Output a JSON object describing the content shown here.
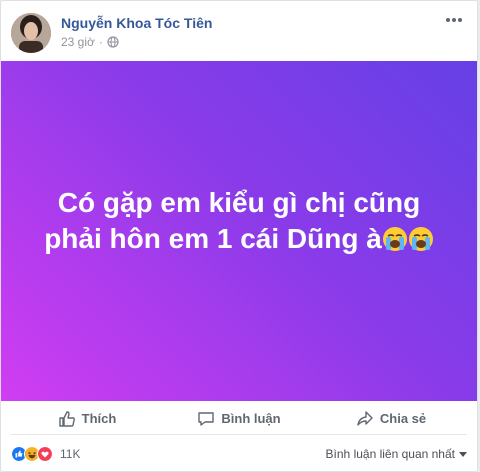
{
  "post": {
    "author": "Nguyễn Khoa Tóc Tiên",
    "time": "23 giờ",
    "separator": "·",
    "message": "Có gặp em kiểu gì chị cũng phải hôn em 1 cái Dũng à",
    "emojis": [
      "loudly-crying-face",
      "loudly-crying-face"
    ],
    "gradient": [
      "#6540e6",
      "#d13df2"
    ]
  },
  "actions": {
    "like": "Thích",
    "comment": "Bình luận",
    "share": "Chia sẻ"
  },
  "footer": {
    "reaction_icons": [
      "like-reaction-icon",
      "haha-reaction-icon",
      "love-reaction-icon"
    ],
    "reaction_count": "11K",
    "sort_label": "Bình luận liên quan nhất"
  }
}
